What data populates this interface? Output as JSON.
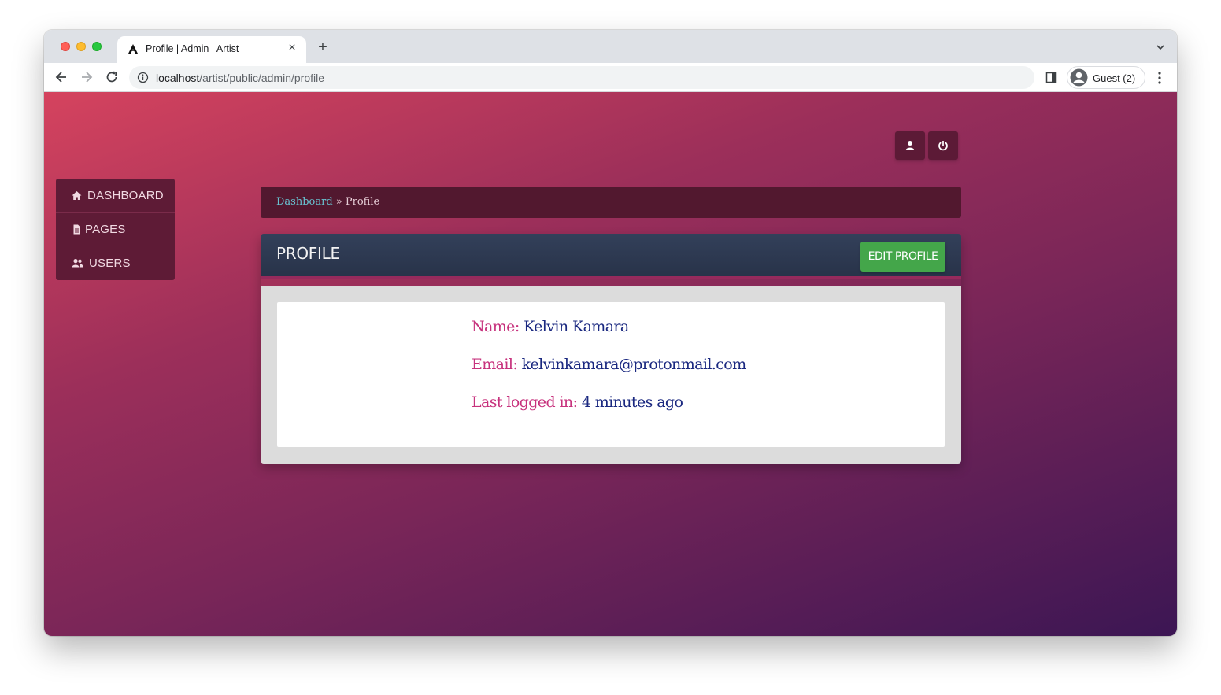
{
  "browser": {
    "tab_title": "Profile | Admin | Artist",
    "url_host": "localhost",
    "url_path": "/artist/public/admin/profile",
    "profile_label": "Guest (2)"
  },
  "sidebar": {
    "items": [
      {
        "label": "DASHBOARD",
        "icon": "home-icon"
      },
      {
        "label": "PAGES",
        "icon": "document-icon"
      },
      {
        "label": "USERS",
        "icon": "users-icon"
      }
    ]
  },
  "breadcrumb": {
    "link": "Dashboard",
    "separator": " » ",
    "current": "Profile"
  },
  "panel": {
    "title": "PROFILE",
    "edit_label": "EDIT PROFILE"
  },
  "profile": {
    "name_label": "Name:",
    "name_value": "Kelvin Kamara",
    "email_label": "Email:",
    "email_value": "kelvinkamara@protonmail.com",
    "last_login_label": "Last logged in:",
    "last_login_value": "4 minutes ago"
  },
  "colors": {
    "accent_green": "#44a64a",
    "label_pink": "#c7327d",
    "value_navy": "#1a2880"
  }
}
